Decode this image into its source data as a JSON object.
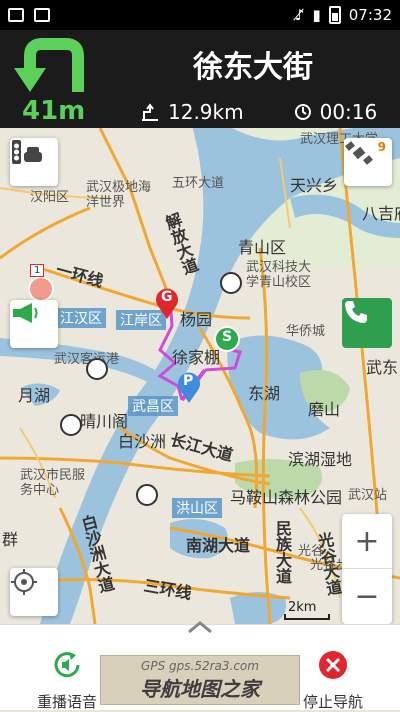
{
  "status_bar": {
    "time": "07:32"
  },
  "header": {
    "next_distance": "41m",
    "street_name": "徐东大街",
    "remaining_distance": "12.9km",
    "remaining_time": "00:16",
    "turn_icon": "u-turn-left-icon"
  },
  "map": {
    "labels": {
      "l1": "五环大道",
      "l2": "汉阳区",
      "l3": "解放大道",
      "l4": "青山区",
      "l5": "武汉科技大学青山校区",
      "l6": "武汉理工大学",
      "l7": "天兴乡",
      "l8": "八吉府",
      "l9": "武汉极地海洋世界",
      "l10": "一环线",
      "l11": "江汉区",
      "l12": "江岸区",
      "l13": "杨园",
      "l14": "华侨城",
      "l15": "武汉客运港",
      "l16": "徐家棚",
      "l17": "月湖",
      "l18": "晴川阁",
      "l19": "武昌区",
      "l20": "东湖",
      "l21": "磨山",
      "l22": "白沙洲",
      "l23": "长江大道",
      "l24": "滨湖湿地",
      "l25": "武汉市民服务中心",
      "l26": "马鞍山森林公园",
      "l27": "洪山区",
      "l28": "南湖大道",
      "l29": "民族大道",
      "l30": "光谷",
      "l31": "白沙洲大道",
      "l32": "三环线",
      "l33": "武东",
      "l34": "武汉站",
      "l35": "群",
      "l36": "光谷大道",
      "l37": "光谷步行街"
    },
    "markers": {
      "destination": "G",
      "start": "S",
      "parking": "P"
    },
    "route_badge": "1",
    "gps_satellites": "9",
    "scale": "2km"
  },
  "bottom_bar": {
    "replay_label": "重播语音",
    "stop_label": "停止导航",
    "ad_line1": "GPS gps.52ra3.com",
    "ad_line2": "导航地图之家"
  }
}
